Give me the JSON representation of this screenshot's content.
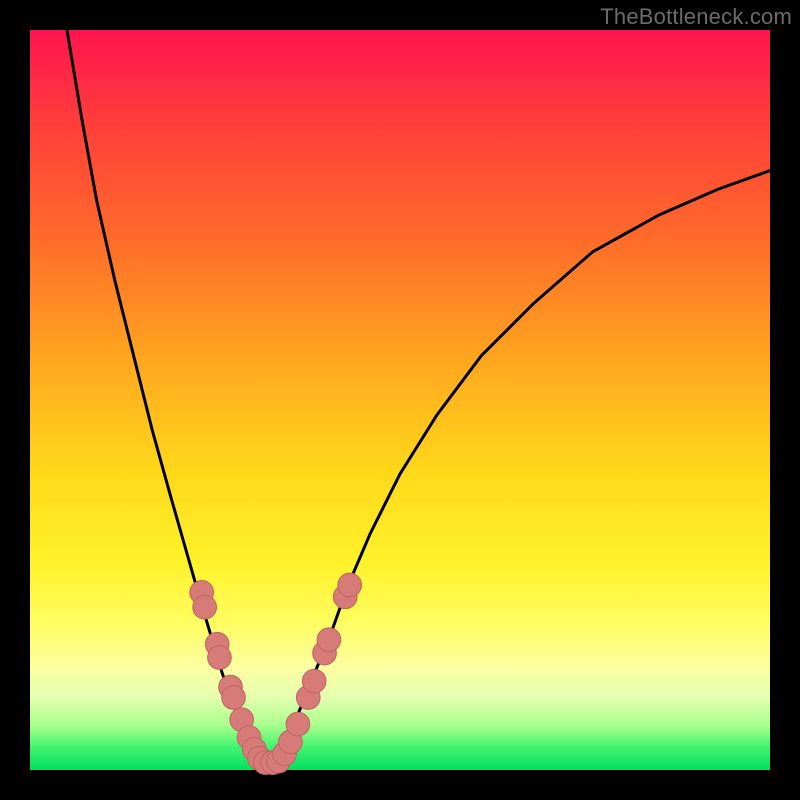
{
  "watermark": "TheBottleneck.com",
  "colors": {
    "frame": "#000000",
    "curve": "#000000",
    "marker_fill": "#d67b78",
    "marker_stroke": "#c26360",
    "gradient_stops": [
      "#ff1450",
      "#ff3c3c",
      "#ff6a2a",
      "#ffa81e",
      "#ffd91a",
      "#fff22a",
      "#fffd60",
      "#fdffa0",
      "#e6ffb0",
      "#a8ff8c",
      "#40f26e",
      "#00e060"
    ]
  },
  "chart_data": {
    "type": "line",
    "title": "",
    "xlabel": "",
    "ylabel": "",
    "xlim": [
      0,
      100
    ],
    "ylim": [
      0,
      100
    ],
    "grid": false,
    "series": [
      {
        "name": "left-curve",
        "x": [
          5,
          7,
          9,
          11.5,
          14,
          16.5,
          19,
          21,
          23,
          24.5,
          26,
          27.5,
          28.8,
          30,
          31,
          32
        ],
        "y": [
          100,
          88,
          77,
          66,
          56,
          46,
          37,
          30,
          23,
          18,
          13,
          9,
          6,
          3.5,
          2,
          1.2
        ]
      },
      {
        "name": "right-curve",
        "x": [
          32,
          33,
          34.5,
          36,
          38,
          40.5,
          43,
          46,
          50,
          55,
          61,
          68,
          76,
          85,
          93,
          100
        ],
        "y": [
          1.2,
          2,
          4,
          7,
          12,
          18,
          25,
          32,
          40,
          48,
          56,
          63,
          70,
          75,
          78.5,
          81
        ]
      },
      {
        "name": "bottom-flat",
        "x": [
          30.5,
          33.5
        ],
        "y": [
          1.0,
          1.0
        ]
      }
    ],
    "markers": [
      {
        "x": 23.2,
        "y": 24,
        "r": 1.6
      },
      {
        "x": 23.6,
        "y": 22,
        "r": 1.6
      },
      {
        "x": 25.3,
        "y": 17,
        "r": 1.6
      },
      {
        "x": 25.6,
        "y": 15.2,
        "r": 1.6
      },
      {
        "x": 27.1,
        "y": 11.2,
        "r": 1.6
      },
      {
        "x": 27.5,
        "y": 9.8,
        "r": 1.6
      },
      {
        "x": 28.6,
        "y": 6.8,
        "r": 1.6
      },
      {
        "x": 29.6,
        "y": 4.4,
        "r": 1.6
      },
      {
        "x": 30.3,
        "y": 2.8,
        "r": 1.6
      },
      {
        "x": 31.0,
        "y": 1.6,
        "r": 1.6
      },
      {
        "x": 31.8,
        "y": 1.0,
        "r": 1.6
      },
      {
        "x": 32.8,
        "y": 1.0,
        "r": 1.6
      },
      {
        "x": 33.6,
        "y": 1.2,
        "r": 1.6
      },
      {
        "x": 34.4,
        "y": 2.2,
        "r": 1.6
      },
      {
        "x": 35.2,
        "y": 3.8,
        "r": 1.6
      },
      {
        "x": 36.2,
        "y": 6.2,
        "r": 1.6
      },
      {
        "x": 37.6,
        "y": 9.8,
        "r": 1.6
      },
      {
        "x": 38.4,
        "y": 12.0,
        "r": 1.6
      },
      {
        "x": 39.8,
        "y": 15.8,
        "r": 1.6
      },
      {
        "x": 40.4,
        "y": 17.6,
        "r": 1.6
      },
      {
        "x": 42.6,
        "y": 23.4,
        "r": 1.6
      },
      {
        "x": 43.2,
        "y": 25.0,
        "r": 1.6
      }
    ]
  }
}
